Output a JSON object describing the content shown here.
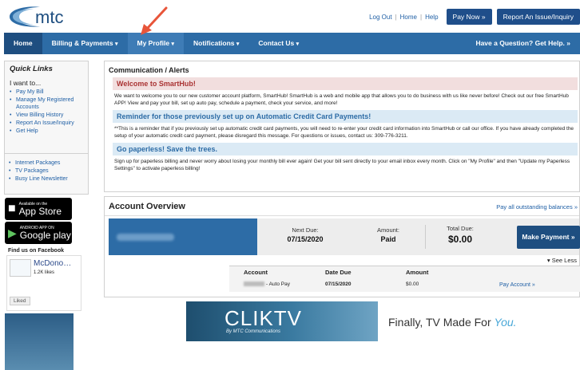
{
  "brand": {
    "logo_text": "mtc",
    "accent": "#2d6ca6",
    "dark": "#1e4e80"
  },
  "header": {
    "links": [
      "Log Out",
      "Home",
      "Help"
    ],
    "pay_now": "Pay Now »",
    "report_issue": "Report An Issue/Inquiry"
  },
  "nav": {
    "items": [
      "Home",
      "Billing & Payments",
      "My Profile",
      "Notifications",
      "Contact Us"
    ],
    "question": "Have a Question? Get Help. »"
  },
  "sidebar": {
    "title": "Quick Links",
    "subtitle": "I want to...",
    "links": [
      "Pay My Bill",
      "Manage My Registered Accounts",
      "View Billing History",
      "Report An Issue/Inquiry",
      "Get Help"
    ],
    "links2": [
      "Internet Packages",
      "TV Packages",
      "Busy Line Newsletter"
    ],
    "app_store": {
      "small": "Available on the",
      "big": "App Store"
    },
    "google_play": {
      "small": "ANDROID APP ON",
      "big": "Google play"
    },
    "facebook": {
      "title": "Find us on Facebook",
      "name": "McDono…",
      "likes": "1.2K likes",
      "liked": "Liked"
    }
  },
  "alerts": {
    "title": "Communication / Alerts",
    "items": [
      {
        "heading": "Welcome to SmartHub!",
        "body": "We want to welcome you to our new customer account platform, SmartHub! SmartHub is a web and mobile app that allows you to do business with us like never before! Check out our free SmartHub APP! View and pay your bill, set up auto pay, schedule a payment, check your service, and more!"
      },
      {
        "heading": "Reminder for those previously set up on Automatic Credit Card Payments!",
        "body": "**This is a reminder that if you previously set up automatic credit card payments, you will need to re-enter your credit card information into SmartHub or call our office. If you have already completed the setup of your automatic credit card payment, please disregard this message. For questions or issues, contact us: 309-776-3211."
      },
      {
        "heading": "Go paperless! Save the trees.",
        "body": "Sign up for paperless billing and never worry about losing your monthly bill ever again! Get your bill sent directly to your email inbox every month. Click on \"My Profile\" and then \"Update my Paperless Settings\" to activate paperless billing!"
      }
    ]
  },
  "overview": {
    "title": "Account Overview",
    "pay_all": "Pay all outstanding balances »",
    "next_due_label": "Next Due:",
    "next_due": "07/15/2020",
    "amount_label": "Amount:",
    "amount": "Paid",
    "total_due_label": "Total Due:",
    "total_due": "$0.00",
    "make_payment": "Make Payment »",
    "see_less": "▾ See Less",
    "table": {
      "headers": [
        "Account",
        "Date Due",
        "Amount"
      ],
      "row": {
        "account": "- Auto Pay",
        "date": "07/15/2020",
        "amount": "$0.00",
        "link": "Pay Account »"
      }
    }
  },
  "banner": {
    "brand": "CLIKTV",
    "sub": "By MTC Communications",
    "text": "Finally, TV Made For",
    "you": "You."
  }
}
